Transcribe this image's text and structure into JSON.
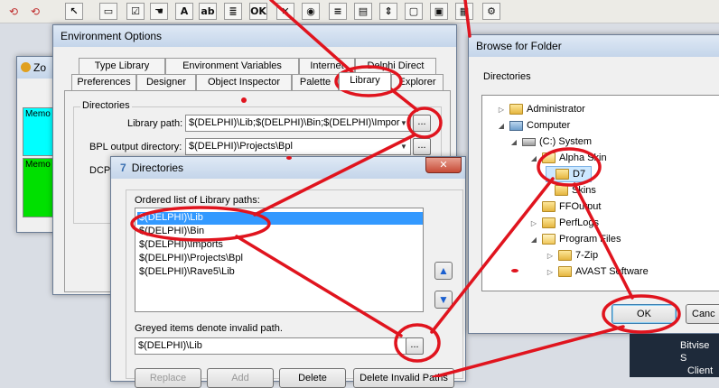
{
  "environment_options": {
    "title": "Environment Options",
    "tabs_row1": [
      "Type Library",
      "Environment Variables",
      "Internet",
      "Delphi Direct"
    ],
    "tabs_row2": [
      "Preferences",
      "Designer",
      "Object Inspector",
      "Palette",
      "Library",
      "Explorer"
    ],
    "active_tab": "Library",
    "group_label": "Directories",
    "library_path_label": "Library path:",
    "library_path_value": "$(DELPHI)\\Lib;$(DELPHI)\\Bin;$(DELPHI)\\Impor",
    "bpl_label": "BPL output directory:",
    "bpl_value": "$(DELPHI)\\Projects\\Bpl",
    "dcp_label": "DCP",
    "browse_label": "..."
  },
  "background_window": {
    "title_fragment": "Zo",
    "memo_labels": [
      "Memo",
      "Memo"
    ]
  },
  "directories_dialog": {
    "title": "Directories",
    "list_label": "Ordered list of Library paths:",
    "paths": [
      "$(DELPHI)\\Lib",
      "$(DELPHI)\\Bin",
      "$(DELPHI)\\Imports",
      "$(DELPHI)\\Projects\\Bpl",
      "$(DELPHI)\\Rave5\\Lib"
    ],
    "selected_index": 0,
    "hint": "Greyed items denote invalid path.",
    "path_value": "$(DELPHI)\\Lib",
    "browse_label": "...",
    "buttons": [
      "Replace",
      "Add",
      "Delete",
      "Delete Invalid Paths"
    ]
  },
  "browse_folder": {
    "title": "Browse for Folder",
    "directories_label": "Directories",
    "tree": [
      {
        "label": "Administrator",
        "level": 0,
        "expander": "▷",
        "icon": "user-folder"
      },
      {
        "label": "Computer",
        "level": 0,
        "expander": "◢",
        "icon": "computer"
      },
      {
        "label": "(C:) System",
        "level": 1,
        "expander": "◢",
        "icon": "drive"
      },
      {
        "label": "Alpha Skin",
        "level": 2,
        "expander": "◢",
        "icon": "folder-open"
      },
      {
        "label": "D7",
        "level": 3,
        "expander": "",
        "icon": "folder",
        "selected": true
      },
      {
        "label": "Skins",
        "level": 3,
        "expander": "",
        "icon": "folder"
      },
      {
        "label": "FFOutput",
        "level": 2,
        "expander": "",
        "icon": "folder"
      },
      {
        "label": "PerfLogs",
        "level": 2,
        "expander": "▷",
        "icon": "folder"
      },
      {
        "label": "Program Files",
        "level": 2,
        "expander": "◢",
        "icon": "folder-open"
      },
      {
        "label": "7-Zip",
        "level": 3,
        "expander": "▷",
        "icon": "folder"
      },
      {
        "label": "AVAST Software",
        "level": 3,
        "expander": "▷",
        "icon": "folder"
      }
    ],
    "ok_label": "OK",
    "cancel_label": "Canc"
  },
  "taskbar_hint": {
    "line1": "Bitvise S",
    "line2": "Client"
  },
  "toolbar": {
    "icons": [
      "pointer-icon",
      "frame-icon",
      "checkbox-icon",
      "label-icon",
      "edit-icon",
      "memo-icon",
      "button-icon",
      "close-box-icon",
      "radio-icon",
      "listbox-icon",
      "combobox-icon",
      "scrollbar-icon",
      "panel-icon",
      "action-icon"
    ],
    "label_letter": "A"
  },
  "colors": {
    "annotation_red": "#e0141e",
    "selection_blue": "#3399ff",
    "memo_cyan": "#00ffff",
    "memo_green": "#00e000"
  }
}
